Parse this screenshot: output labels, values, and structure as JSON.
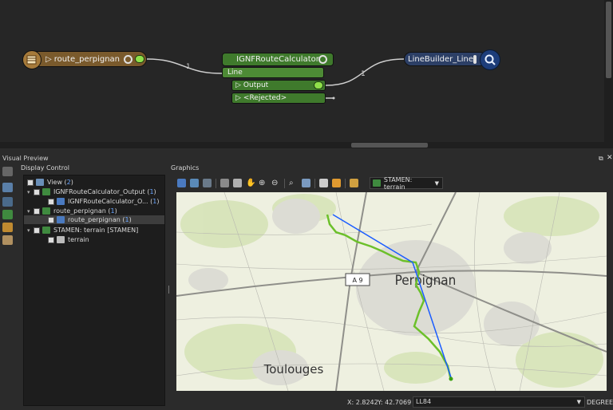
{
  "canvas": {
    "reader": {
      "label": "route_perpignan"
    },
    "transformer": {
      "name": "IGNFRouteCalculator",
      "input_port": "Line",
      "output_port": "Output",
      "rejected_port": "<Rejected>"
    },
    "writer": {
      "label": "LineBuilder_Line"
    },
    "link_counts": [
      "1",
      "1"
    ]
  },
  "preview": {
    "title": "Visual Preview",
    "display_control_title": "Display Control",
    "graphics_title": "Graphics",
    "tree": [
      {
        "label": "View ( ",
        "count": "2",
        "suffix": " )",
        "indent": 0,
        "expand": ""
      },
      {
        "label": "IGNFRouteCalculator_Output ( ",
        "count": "1",
        "suffix": " )",
        "indent": 1,
        "expand": "▾"
      },
      {
        "label": "IGNFRouteCalculator_O... ( ",
        "count": "1",
        "suffix": " )",
        "indent": 2,
        "expand": ""
      },
      {
        "label": "route_perpignan ( ",
        "count": "1",
        "suffix": " )",
        "indent": 1,
        "expand": "▾"
      },
      {
        "label": "route_perpignan ( ",
        "count": "1",
        "suffix": " )",
        "indent": 2,
        "expand": ""
      },
      {
        "label": "STAMEN: terrain [STAMEN]",
        "count": "",
        "suffix": "",
        "indent": 1,
        "expand": "▾"
      },
      {
        "label": "terrain",
        "count": "",
        "suffix": "",
        "indent": 2,
        "expand": ""
      }
    ],
    "basemap_select": "STAMEN: terrain",
    "map": {
      "city_label": "Perpignan",
      "town_label": "Toulouges",
      "road_label": "A 9",
      "colors": {
        "route": "#6cc02a",
        "line": "#1a5cff",
        "land": "#eef0e0"
      }
    },
    "status": {
      "x_label": "X:",
      "x_value": "2.8242",
      "y_label": "Y:",
      "y_value": "42.7069",
      "crs": "LL84",
      "units": "DEGREE"
    }
  }
}
